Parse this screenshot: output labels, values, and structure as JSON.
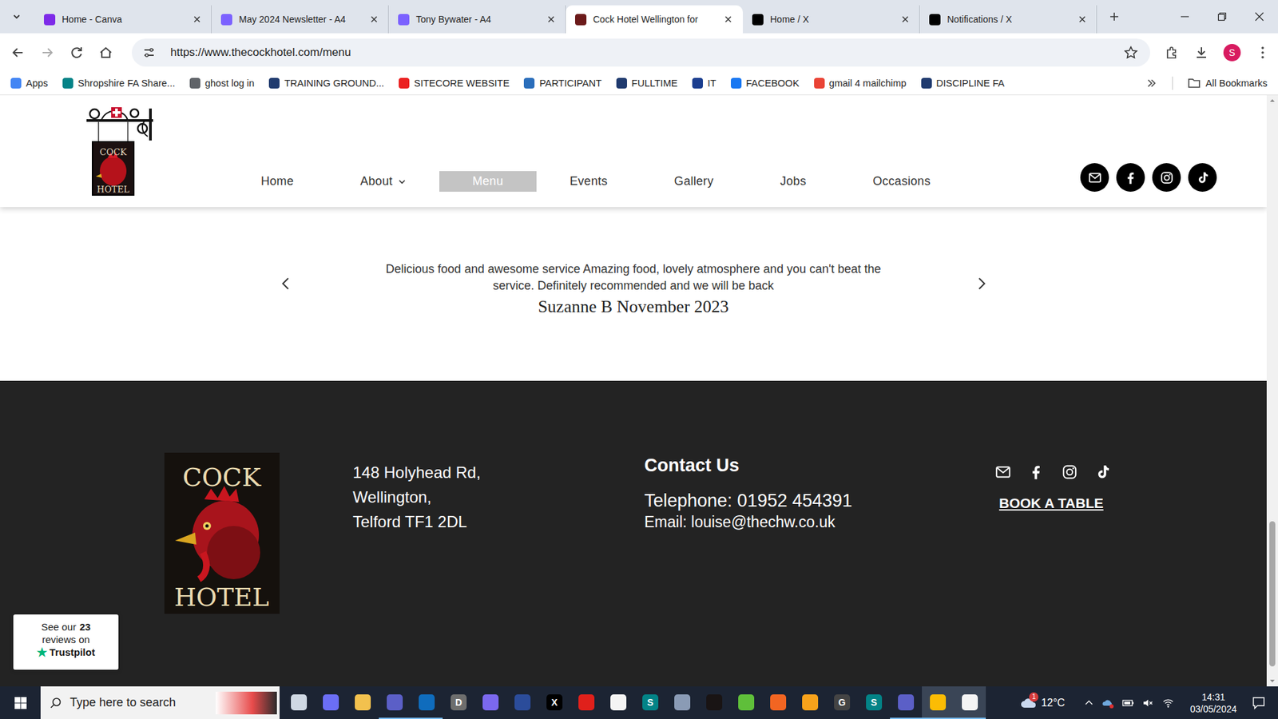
{
  "browser": {
    "tabs": [
      {
        "label": "Home - Canva",
        "selected": false,
        "icon_color": "#7d2ae8"
      },
      {
        "label": "May 2024 Newsletter - A4",
        "selected": false,
        "icon_color": "#7b61ff"
      },
      {
        "label": "Tony Bywater - A4",
        "selected": false,
        "icon_color": "#7b61ff"
      },
      {
        "label": "Cock Hotel Wellington for",
        "selected": true,
        "icon_color": "#6b1a1a"
      },
      {
        "label": "Home / X",
        "selected": false,
        "icon_color": "#000000"
      },
      {
        "label": "Notifications / X",
        "selected": false,
        "icon_color": "#000000"
      }
    ],
    "url": "https://www.thecockhotel.com/menu",
    "profile": "S",
    "bookmarks": [
      {
        "label": "Apps",
        "icon_color": "#4285f4"
      },
      {
        "label": "Shropshire FA Share...",
        "icon_color": "#038387"
      },
      {
        "label": "ghost log in",
        "icon_color": "#5f6368"
      },
      {
        "label": "TRAINING GROUND...",
        "icon_color": "#1f3a6e"
      },
      {
        "label": "SITECORE WEBSITE",
        "icon_color": "#eb1f1f"
      },
      {
        "label": "PARTICIPANT",
        "icon_color": "#2a6ebb"
      },
      {
        "label": "FULLTIME",
        "icon_color": "#1f3a6e"
      },
      {
        "label": "IT",
        "icon_color": "#1a3d8f"
      },
      {
        "label": "FACEBOOK",
        "icon_color": "#1877f2"
      },
      {
        "label": "gmail 4 mailchimp",
        "icon_color": "#ea4335"
      },
      {
        "label": "DISCIPLINE FA",
        "icon_color": "#1f3a6e"
      }
    ],
    "all_bookmarks": "All Bookmarks"
  },
  "site": {
    "logo": [
      "COCK",
      "HOTEL"
    ],
    "nav": [
      {
        "label": "Home",
        "selected": false,
        "dropdown": false
      },
      {
        "label": "About",
        "selected": false,
        "dropdown": true
      },
      {
        "label": "Menu",
        "selected": true,
        "dropdown": false
      },
      {
        "label": "Events",
        "selected": false,
        "dropdown": false
      },
      {
        "label": "Gallery",
        "selected": false,
        "dropdown": false
      },
      {
        "label": "Jobs",
        "selected": false,
        "dropdown": false
      },
      {
        "label": "Occasions",
        "selected": false,
        "dropdown": false
      }
    ],
    "testimonial": {
      "text": "Delicious food and awesome service Amazing food, lovely atmosphere and you can't beat the service. Definitely recommended and we will be back",
      "author": "Suzanne B November 2023"
    },
    "footer": {
      "address": [
        "148 Holyhead Rd,",
        "Wellington,",
        "Telford TF1 2DL"
      ],
      "contact_title": "Contact Us",
      "telephone": "Telephone: 01952 454391",
      "email": "Email: louise@thechw.co.uk",
      "book": "BOOK A TABLE"
    },
    "trustpilot": {
      "line1": "See our",
      "count": "23",
      "line2": "reviews on",
      "star": "★",
      "brand": "Trustpilot"
    }
  },
  "scrollbar": {
    "level": 0.98
  },
  "taskbar": {
    "search_placeholder": "Type here to search",
    "apps": [
      {
        "glyph": "",
        "color": "#cfd8e3",
        "running": false,
        "selected": false
      },
      {
        "glyph": "",
        "color": "#6b6ef5",
        "running": false,
        "selected": false
      },
      {
        "glyph": "",
        "color": "#f2c14e",
        "running": false,
        "selected": false
      },
      {
        "glyph": "",
        "color": "#5b5fc7",
        "running": true,
        "selected": false
      },
      {
        "glyph": "",
        "color": "#0f6cbd",
        "running": true,
        "selected": false
      },
      {
        "glyph": "D",
        "color": "#6e6e6e",
        "running": false,
        "selected": false
      },
      {
        "glyph": "",
        "color": "#7b68ee",
        "running": false,
        "selected": false
      },
      {
        "glyph": "",
        "color": "#2b4c9a",
        "running": false,
        "selected": false
      },
      {
        "glyph": "X",
        "color": "#000000",
        "running": false,
        "selected": false
      },
      {
        "glyph": "",
        "color": "#e0201b",
        "running": false,
        "selected": false
      },
      {
        "glyph": "",
        "color": "#f4f4f4",
        "running": false,
        "selected": false
      },
      {
        "glyph": "S",
        "color": "#038387",
        "running": false,
        "selected": false
      },
      {
        "glyph": "",
        "color": "#8a9bb5",
        "running": false,
        "selected": false
      },
      {
        "glyph": "",
        "color": "#191414",
        "running": false,
        "selected": false
      },
      {
        "glyph": "",
        "color": "#5fbf3a",
        "running": false,
        "selected": false
      },
      {
        "glyph": "",
        "color": "#f26522",
        "running": false,
        "selected": false
      },
      {
        "glyph": "",
        "color": "#f7a21b",
        "running": false,
        "selected": false
      },
      {
        "glyph": "G",
        "color": "#444444",
        "running": false,
        "selected": false
      },
      {
        "glyph": "S",
        "color": "#038387",
        "running": false,
        "selected": false
      },
      {
        "glyph": "",
        "color": "#5b5fc7",
        "running": true,
        "selected": false
      },
      {
        "glyph": "",
        "color": "#fbbc04",
        "running": true,
        "selected": true
      },
      {
        "glyph": "",
        "color": "#f4f4f4",
        "running": true,
        "selected": true
      }
    ],
    "weather_badge": "1",
    "temperature": "12°C",
    "time": "14:31",
    "date": "03/05/2024"
  }
}
